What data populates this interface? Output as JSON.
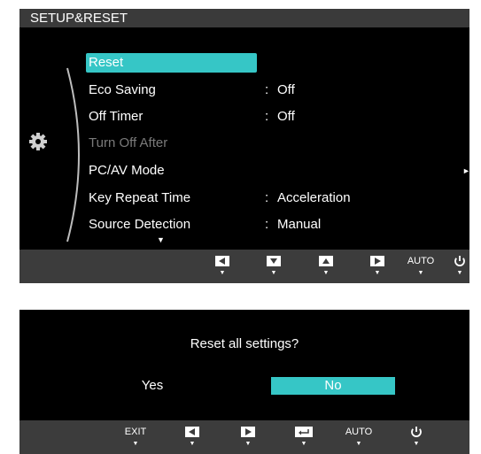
{
  "osd_menu": {
    "title": "SETUP&RESET",
    "items": [
      {
        "label": "Reset",
        "value": "",
        "state": "selected"
      },
      {
        "label": "Eco Saving",
        "value": "Off",
        "state": "normal"
      },
      {
        "label": "Off Timer",
        "value": "Off",
        "state": "normal"
      },
      {
        "label": "Turn Off After",
        "value": "",
        "state": "disabled"
      },
      {
        "label": "PC/AV Mode",
        "value": "",
        "state": "normal"
      },
      {
        "label": "Key Repeat Time",
        "value": "Acceleration",
        "state": "normal"
      },
      {
        "label": "Source Detection",
        "value": "Manual",
        "state": "normal"
      }
    ],
    "value_separator": ":",
    "toolbar": {
      "left_icon": "left-arrow-icon",
      "down_icon": "down-arrow-icon",
      "up_icon": "up-arrow-icon",
      "right_icon": "right-arrow-icon",
      "auto_label": "AUTO",
      "power_icon": "power-icon"
    },
    "side_icon": "gear-icon",
    "accent_color": "#36c6c6"
  },
  "reset_dialog": {
    "question": "Reset all settings?",
    "yes_label": "Yes",
    "no_label": "No",
    "selected": "No",
    "toolbar": {
      "exit_label": "EXIT",
      "left_icon": "left-arrow-icon",
      "right_icon": "right-arrow-icon",
      "enter_icon": "enter-icon",
      "auto_label": "AUTO",
      "power_icon": "power-icon"
    }
  }
}
